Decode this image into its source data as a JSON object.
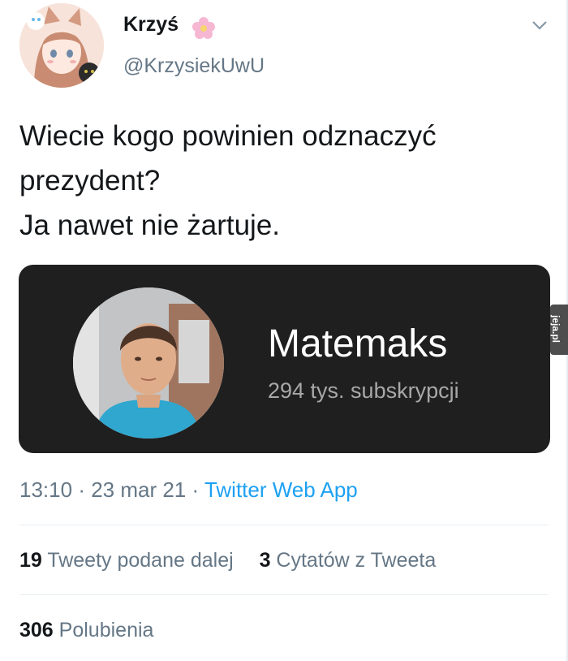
{
  "author": {
    "display_name": "Krzyś",
    "handle": "@KrzysiekUwU",
    "avatar_icon": "anime-cat-avatar-icon",
    "badge_icon": "flower-emoji-icon"
  },
  "tweet": {
    "text_lines": [
      "Wiecie kogo powinien odznaczyć",
      "prezydent?",
      "Ja nawet nie żartuje."
    ],
    "time": "13:10",
    "date": "23 mar 21",
    "source": "Twitter Web App"
  },
  "card": {
    "channel_name": "Matemaks",
    "subscribers": "294 tys. subskrypcji"
  },
  "stats": {
    "retweets_count": "19",
    "retweets_label": "Tweety podane dalej",
    "quotes_count": "3",
    "quotes_label": "Cytatów z Tweeta",
    "likes_count": "306",
    "likes_label": "Polubienia"
  },
  "watermark": "jeja.pl",
  "colors": {
    "text": "#14171a",
    "secondary": "#657786",
    "link": "#1da1f2",
    "card_bg": "#1f1f1f"
  }
}
